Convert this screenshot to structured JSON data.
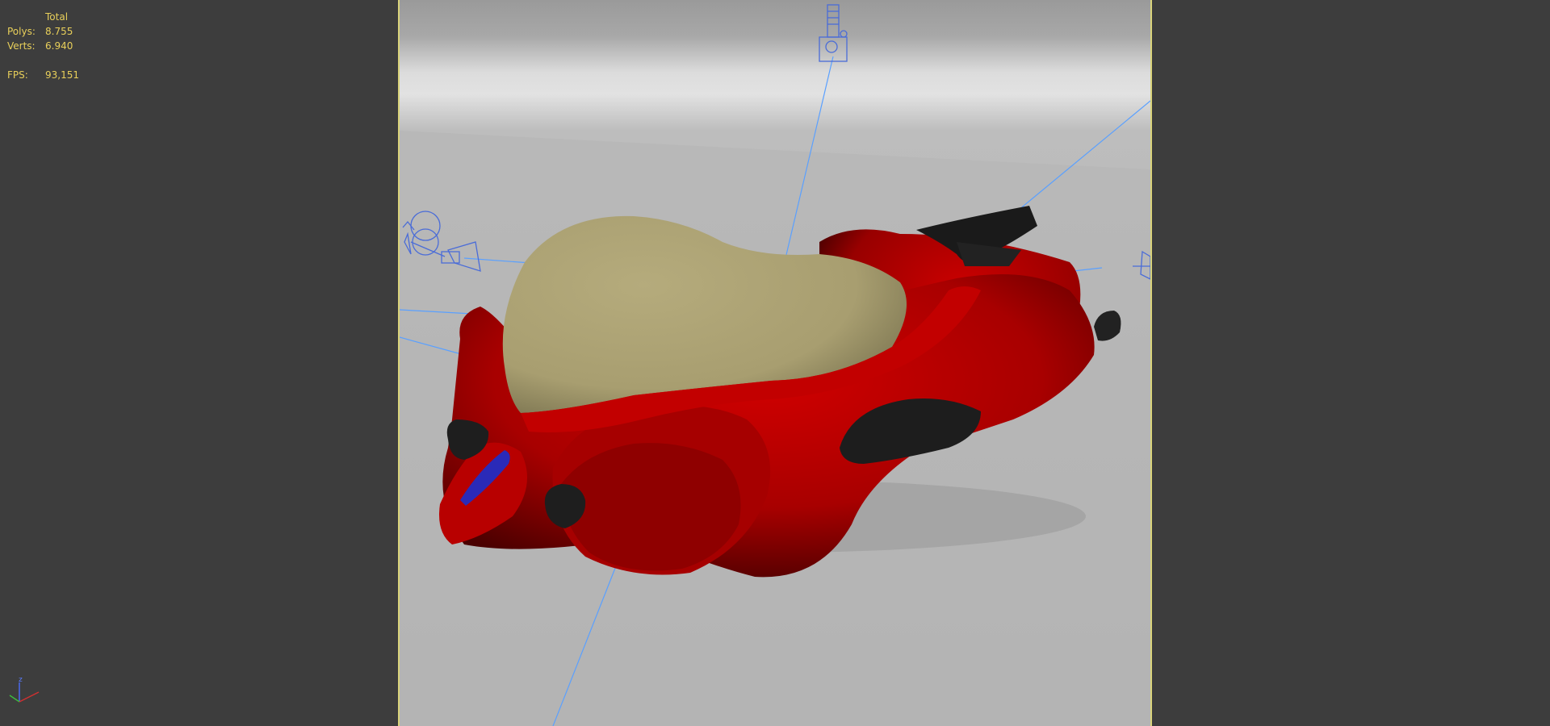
{
  "stats": {
    "header": "Total",
    "polys_label": "Polys:",
    "polys_value": "8.755",
    "verts_label": "Verts:",
    "verts_value": "6.940",
    "fps_label": "FPS:",
    "fps_value": "93,151"
  },
  "axis": {
    "z_label": "z"
  },
  "colors": {
    "background": "#3d3d3d",
    "stats_text": "#e8cf5a",
    "viewport_border": "#d9d37a",
    "car_body": "#b40000",
    "canopy": "#b0a679",
    "helper_lines": "#5aa0ff"
  }
}
